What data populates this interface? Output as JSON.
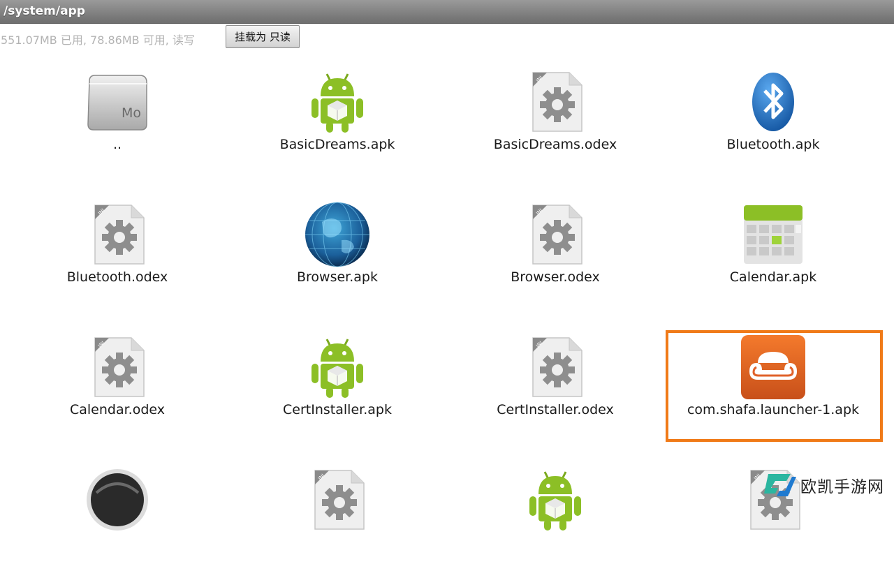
{
  "header": {
    "path": "/system/app"
  },
  "storage": {
    "summary": "551.07MB 已用, 78.86MB 可用, 读写",
    "mount_button": "挂载为 只读"
  },
  "files": [
    {
      "label": "..",
      "icon": "folder-up-icon"
    },
    {
      "label": "BasicDreams.apk",
      "icon": "android-apk-icon"
    },
    {
      "label": "BasicDreams.odex",
      "icon": "odex-file-icon"
    },
    {
      "label": "Bluetooth.apk",
      "icon": "bluetooth-icon"
    },
    {
      "label": "Bluetooth.odex",
      "icon": "odex-file-icon"
    },
    {
      "label": "Browser.apk",
      "icon": "globe-icon"
    },
    {
      "label": "Browser.odex",
      "icon": "odex-file-icon"
    },
    {
      "label": "Calendar.apk",
      "icon": "calendar-icon"
    },
    {
      "label": "Calendar.odex",
      "icon": "odex-file-icon"
    },
    {
      "label": "CertInstaller.apk",
      "icon": "android-apk-icon"
    },
    {
      "label": "CertInstaller.odex",
      "icon": "odex-file-icon"
    },
    {
      "label": "com.shafa.launcher-1.apk",
      "icon": "sofa-app-icon"
    },
    {
      "label": "",
      "icon": "circle-app-icon"
    },
    {
      "label": "",
      "icon": "odex-file-icon"
    },
    {
      "label": "",
      "icon": "android-apk-icon"
    },
    {
      "label": "",
      "icon": "odex-file-icon"
    }
  ],
  "selected_index": 11,
  "watermark": {
    "text": "欧凯手游网"
  },
  "colors": {
    "selection": "#f07a18",
    "android_green": "#8cbf26",
    "bluetooth_blue": "#1e6fc4"
  }
}
